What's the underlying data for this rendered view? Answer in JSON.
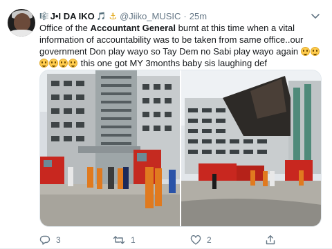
{
  "tweet": {
    "author": {
      "name": "J•I DA IKO",
      "prefix_emoji": "🎼",
      "suffix_emoji": "🎵",
      "extra_emoji": "⚓",
      "handle": "@Jiiko_MUSIC",
      "separator": "·",
      "time": "25m"
    },
    "text": {
      "part1": "Office of the ",
      "bold": "Accountant General",
      "part2": " burnt at this time when a vital information of accountability was to be taken from same office..our government Don play wayo so Tay Dem no Sabi play wayo again",
      "part3": " this one got MY 3months baby sis laughing def"
    },
    "actions": {
      "reply_count": "3",
      "retweet_count": "1",
      "like_count": "2"
    },
    "colors": {
      "accent": "#1da1f2",
      "muted": "#657786",
      "emoji_face": "#ffcc4d"
    },
    "icons": {
      "reply": "reply-icon",
      "retweet": "retweet-icon",
      "like": "heart-icon",
      "share": "share-icon",
      "caret": "chevron-down-icon"
    }
  }
}
